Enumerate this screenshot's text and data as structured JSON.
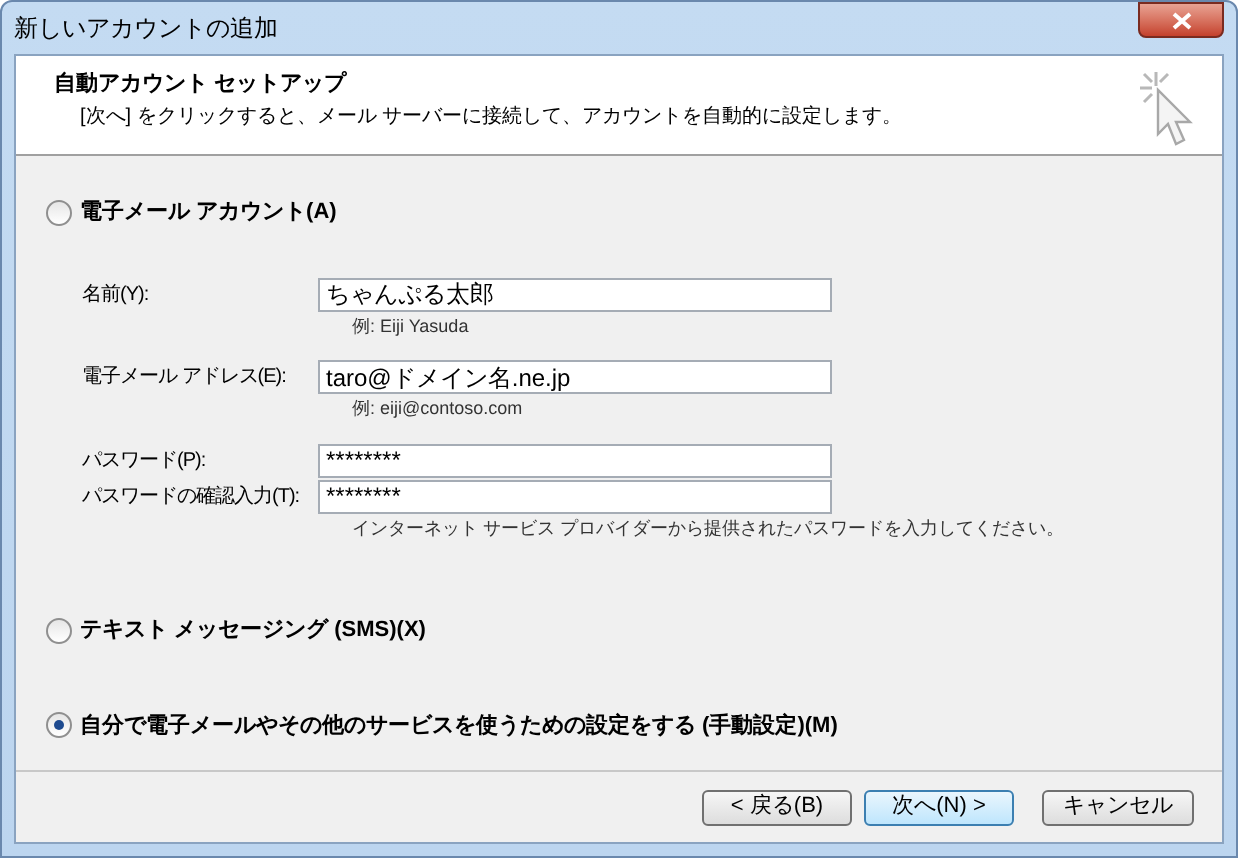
{
  "window": {
    "title": "新しいアカウントの追加"
  },
  "header": {
    "title": "自動アカウント セットアップ",
    "description": "[次へ] をクリックすると、メール サーバーに接続して、アカウントを自動的に設定します。"
  },
  "options": [
    {
      "label": "電子メール アカウント(A)",
      "selected": false,
      "fields": [
        {
          "label": "名前(Y):",
          "value": "ちゃんぷる太郎",
          "hint": "例: Eiji Yasuda"
        },
        {
          "label": "電子メール アドレス(E):",
          "value": "taro@ドメイン名.ne.jp",
          "hint": "例: eiji@contoso.com"
        },
        {
          "label": "パスワード(P):",
          "value": "********"
        },
        {
          "label": "パスワードの確認入力(T):",
          "value": "********",
          "hint": "インターネット サービス プロバイダーから提供されたパスワードを入力してください。"
        }
      ]
    },
    {
      "label": "テキスト メッセージング (SMS)(X)",
      "selected": false
    },
    {
      "label": "自分で電子メールやその他のサービスを使うための設定をする (手動設定)(M)",
      "selected": true
    }
  ],
  "buttons": [
    {
      "label": "< 戻る(B)",
      "default": false
    },
    {
      "label": "次へ(N) >",
      "default": true
    },
    {
      "label": "キャンセル",
      "default": false
    }
  ]
}
